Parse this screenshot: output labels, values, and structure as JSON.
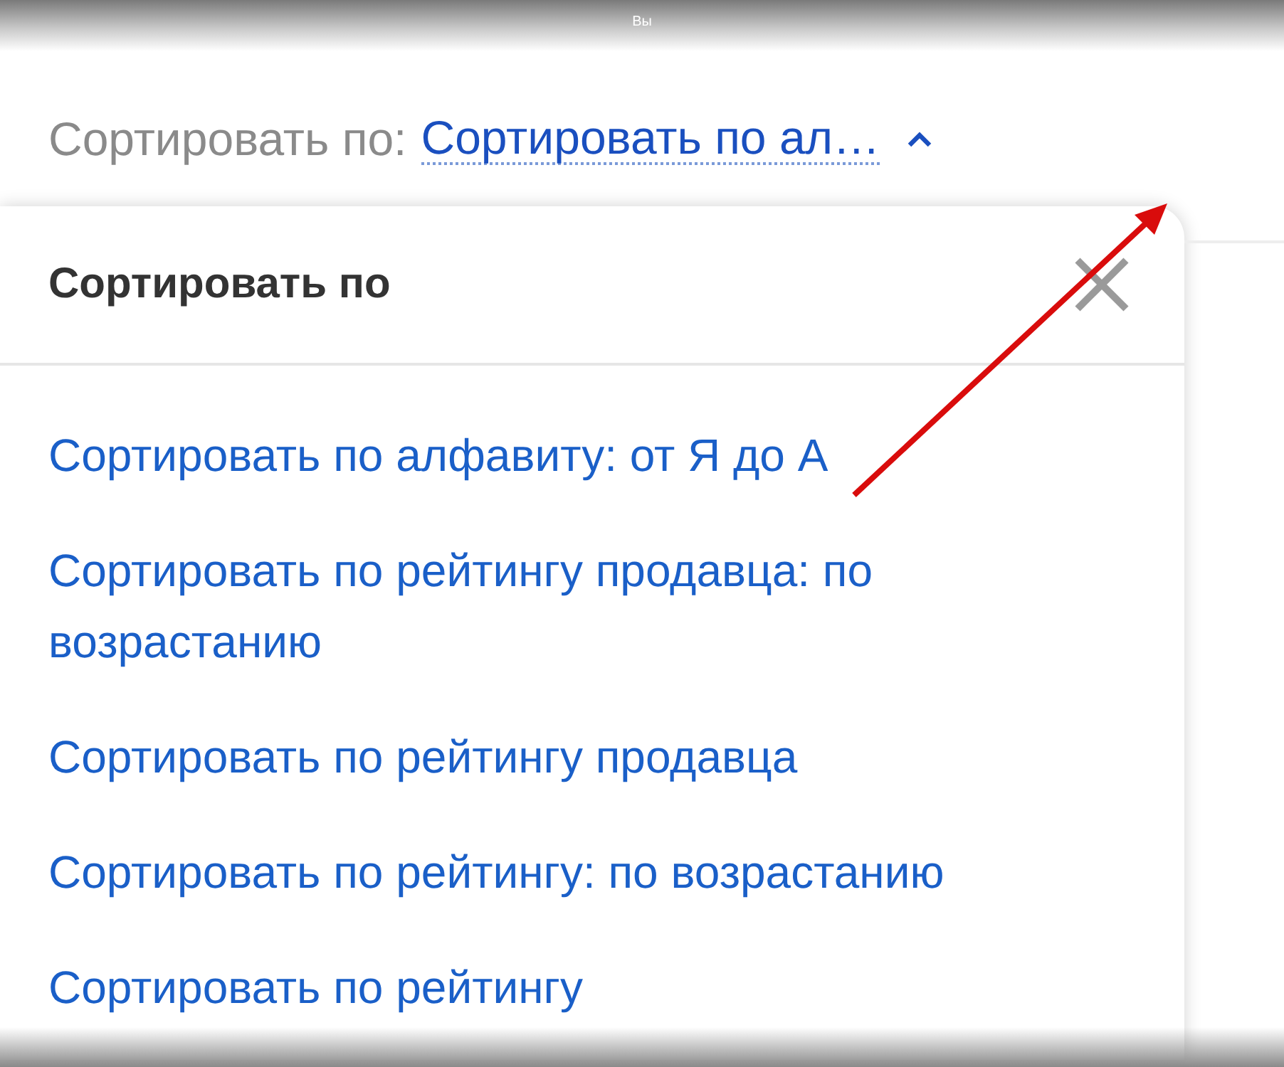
{
  "top_bar": {
    "title": "Вы"
  },
  "sort": {
    "label": "Сортировать по:",
    "value": "Сортировать по ал…",
    "expanded": true
  },
  "popup": {
    "title": "Сортировать по",
    "options": [
      {
        "label": "Сортировать по алфавиту: от Я до А"
      },
      {
        "label": "Сортировать по рейтингу продавца: по возрастанию"
      },
      {
        "label": "Сортировать по рейтингу продавца"
      },
      {
        "label": "Сортировать по рейтингу: по возрастанию"
      },
      {
        "label": "Сортировать по рейтингу"
      }
    ]
  }
}
